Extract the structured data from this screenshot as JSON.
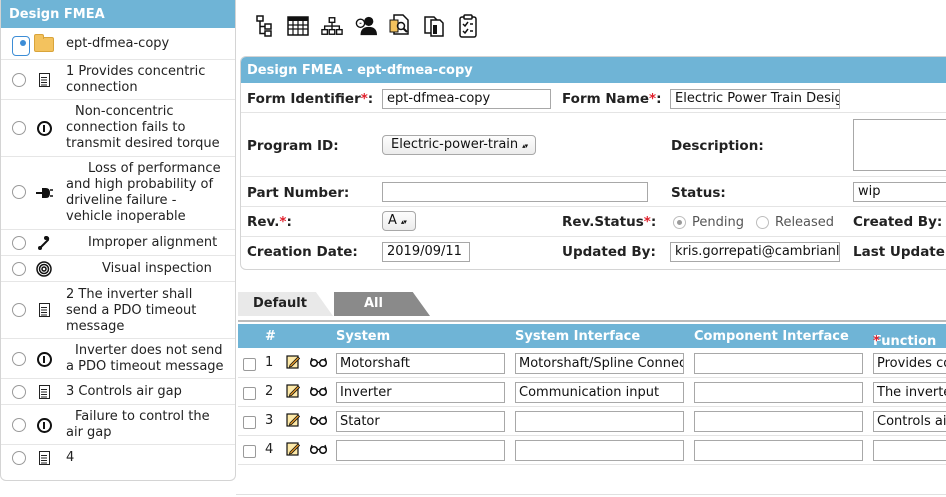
{
  "sidebar": {
    "title": "Design FMEA",
    "items": [
      {
        "label": "ept-dfmea-copy",
        "icon": "folder-icon",
        "selected": true
      },
      {
        "label": "1 Provides concentric connection",
        "icon": "document-icon"
      },
      {
        "label": "Non-concentric connection fails to transmit desired torque",
        "icon": "circle-i-icon"
      },
      {
        "label": "Loss of performance and high probability of driveline failure - vehicle inoperable",
        "icon": "plug-icon"
      },
      {
        "label": "Improper alignment",
        "icon": "cause-icon"
      },
      {
        "label": "Visual inspection",
        "icon": "fingerprint-icon"
      },
      {
        "label": "2 The inverter shall send a PDO timeout message",
        "icon": "document-icon"
      },
      {
        "label": "Inverter does not send a PDO timeout message",
        "icon": "circle-i-icon"
      },
      {
        "label": "3 Controls air gap",
        "icon": "document-icon"
      },
      {
        "label": "Failure to control the air gap",
        "icon": "circle-i-icon"
      },
      {
        "label": "4",
        "icon": "document-icon"
      }
    ]
  },
  "toolbar": {
    "icons": [
      "tree-icon",
      "table-icon",
      "hierarchy-icon",
      "users-icon",
      "doc-search-icon",
      "copy-icon",
      "checklist-icon"
    ]
  },
  "form": {
    "title": "Design FMEA - ept-dfmea-copy",
    "form_identifier_label": "Form Identifier",
    "form_identifier_value": "ept-dfmea-copy",
    "form_name_label": "Form Name",
    "form_name_value": "Electric Power Train Design",
    "program_id_label": "Program ID:",
    "program_id_value": "Electric-power-train",
    "description_label": "Description:",
    "part_number_label": "Part Number:",
    "part_number_value": "",
    "status_label": "Status:",
    "status_value": "wip",
    "rev_label": "Rev.",
    "rev_value": "A",
    "rev_status_label": "Rev.Status",
    "rev_status_options": [
      "Pending",
      "Released"
    ],
    "created_by_label": "Created By:",
    "creation_date_label": "Creation Date:",
    "creation_date_value": "2019/09/11",
    "updated_by_label": "Updated By:",
    "updated_by_value": "kris.gorrepati@cambrianl",
    "last_update_label": "Last Update:",
    "required_mark": "*",
    "colon": ":"
  },
  "tabs": {
    "default": "Default",
    "all": "All"
  },
  "grid": {
    "headers": {
      "num": "#",
      "system": "System",
      "system_interface": "System Interface",
      "component_interface": "Component Interface",
      "function": "Function"
    },
    "rows": [
      {
        "num": "1",
        "system": "Motorshaft",
        "system_interface": "Motorshaft/Spline Connection",
        "component_interface": "",
        "function": "Provides concentric connection"
      },
      {
        "num": "2",
        "system": "Inverter",
        "system_interface": "Communication input",
        "component_interface": "",
        "function": "The inverter shall send a PDO timeout message"
      },
      {
        "num": "3",
        "system": "Stator",
        "system_interface": "",
        "component_interface": "",
        "function": "Controls air gap"
      },
      {
        "num": "4",
        "system": "",
        "system_interface": "",
        "component_interface": "",
        "function": ""
      }
    ]
  }
}
